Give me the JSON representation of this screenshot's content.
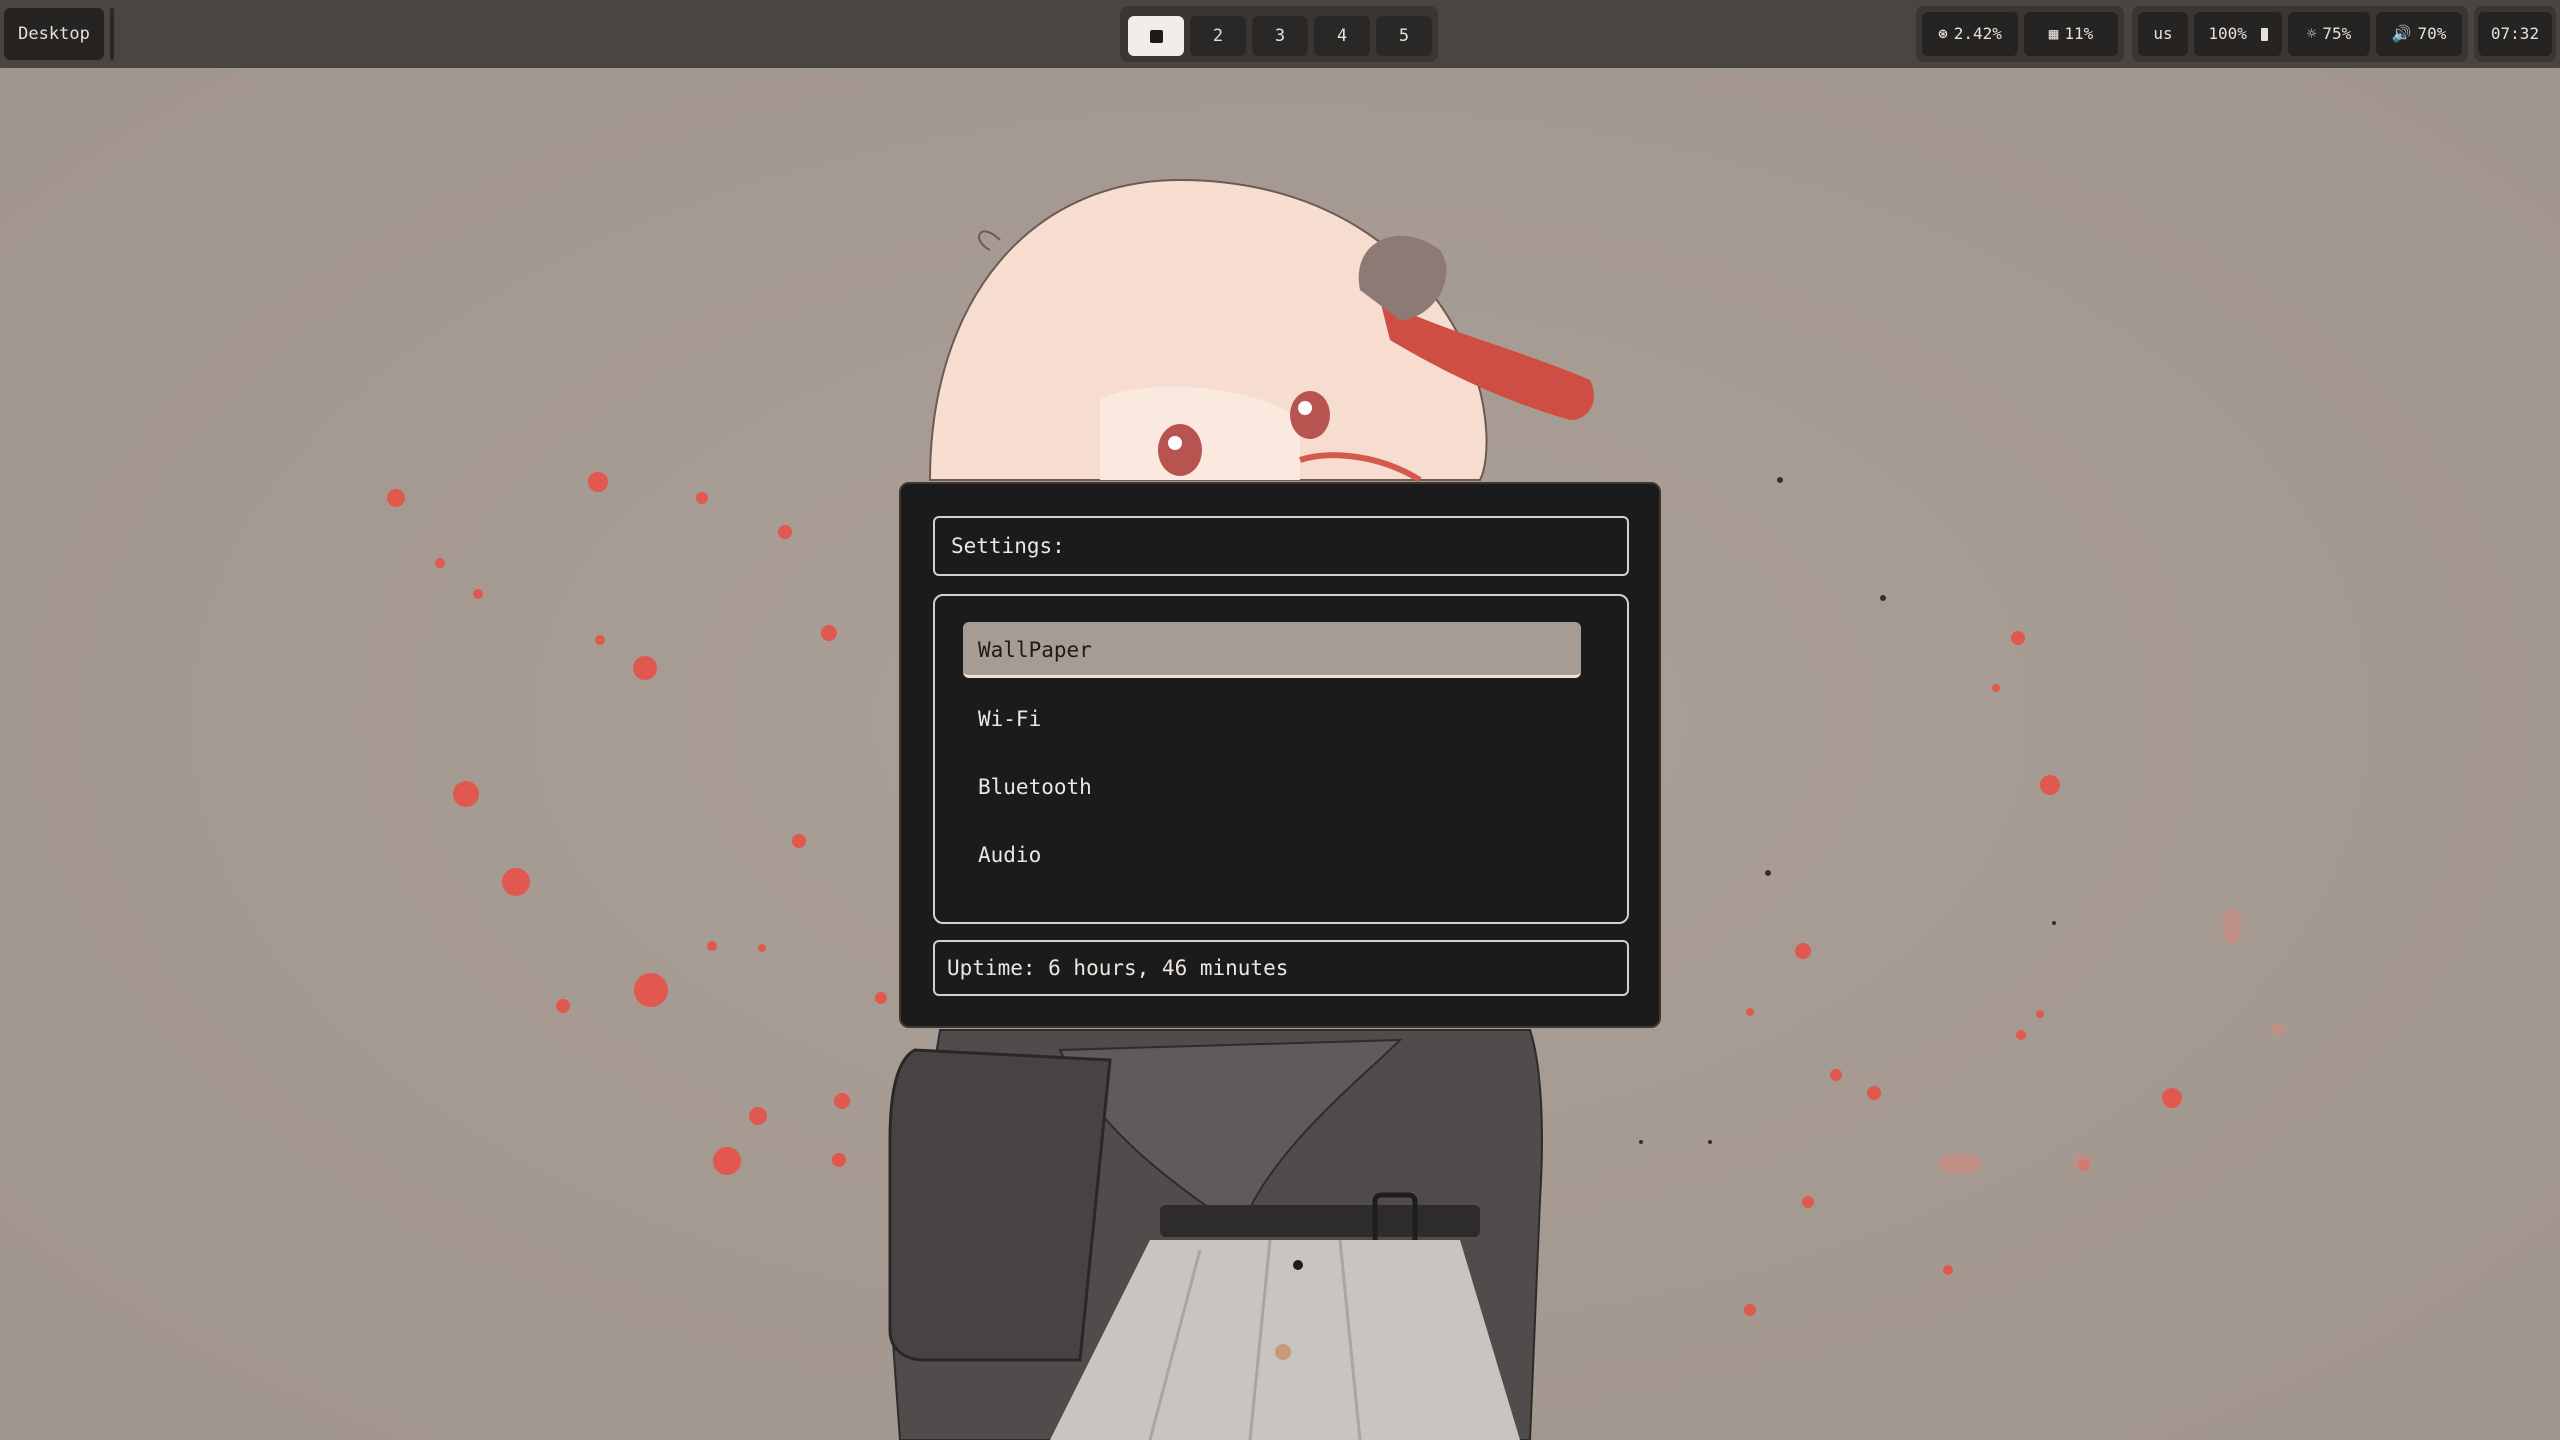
{
  "topbar": {
    "desktop_label": "Desktop",
    "workspaces": [
      "",
      "2",
      "3",
      "4",
      "5"
    ],
    "cpu": "2.42%",
    "memory": "11%",
    "keyboard_layout": "us",
    "battery": "100%",
    "brightness": "75%",
    "volume": "70%",
    "clock": "07:32"
  },
  "launcher": {
    "prompt": "Settings:",
    "items": [
      "WallPaper",
      "Wi-Fi",
      "Bluetooth",
      "Audio"
    ],
    "selected_index": 0,
    "uptime": "Uptime: 6 hours, 46 minutes"
  },
  "colors": {
    "wallpaper_bg": "#a79c94",
    "bar_bg": "#4a4542",
    "modal_bg": "#1c1b1b",
    "accent_petal": "#e0584e",
    "selected_bg": "#a79c94"
  },
  "icons": {
    "cpu": "cpu-icon",
    "memory": "memory-icon",
    "battery": "battery-icon",
    "brightness": "brightness-icon",
    "volume": "volume-icon"
  }
}
